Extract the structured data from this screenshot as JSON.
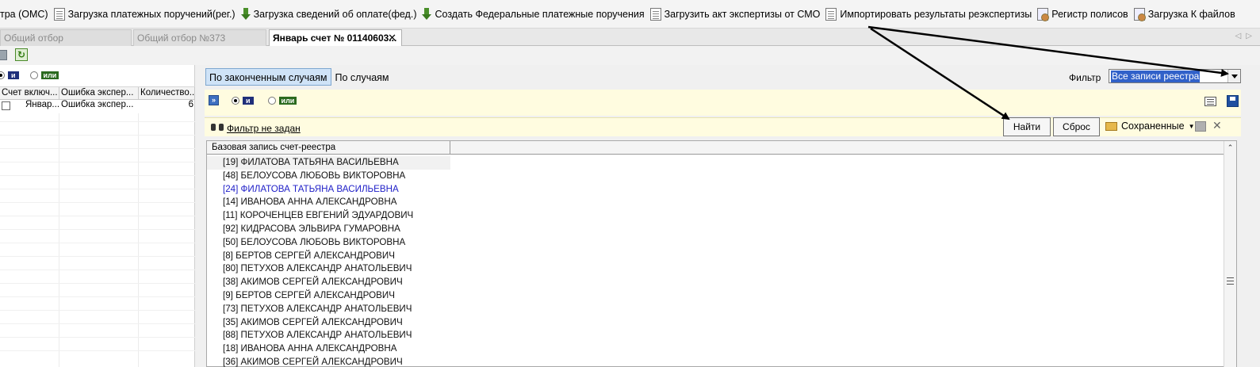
{
  "toolbar": {
    "items": [
      {
        "label": "тра (ОМС)",
        "icon": "none"
      },
      {
        "label": "Загрузка платежных поручений(рег.)",
        "icon": "document-icon"
      },
      {
        "label": "Загрузка сведений об оплате(фед.)",
        "icon": "download-icon"
      },
      {
        "label": "Создать Федеральные платежные поручения",
        "icon": "download-icon"
      },
      {
        "label": "Загрузить акт экспертизы от СМО",
        "icon": "document-icon"
      },
      {
        "label": "Импортировать результаты реэкспертизы",
        "icon": "document-icon"
      },
      {
        "label": "Регистр полисов",
        "icon": "registry-icon"
      },
      {
        "label": "Загрузка К файлов",
        "icon": "registry-icon"
      }
    ]
  },
  "tabs": [
    {
      "label": "Общий отбор",
      "active": false
    },
    {
      "label": "Общий отбор  №373",
      "active": false
    },
    {
      "label": "Январь счет № 01140603...",
      "active": true,
      "close": "✕"
    }
  ],
  "left": {
    "logic": {
      "and": "и",
      "or": "или"
    },
    "columns": [
      "Счет включ...",
      "Ошибка экспер...",
      "Количество..."
    ],
    "rows": [
      {
        "col1": "Январ...",
        "col2": "Ошибка экспер...",
        "col3": "6"
      }
    ]
  },
  "right": {
    "subtabs": [
      "По законченным случаям",
      "По случаям"
    ],
    "filter": {
      "label": "Фильтр",
      "value": "Все записи реестра"
    },
    "logic": {
      "and": "и",
      "or": "или"
    },
    "filter_status": "Фильтр не задан",
    "find_button": "Найти",
    "reset_button": "Сброс",
    "saved_label": "Сохраненные",
    "grid": {
      "header": "Базовая запись счет-реестра",
      "rows": [
        "[19] ФИЛАТОВА ТАТЬЯНА ВАСИЛЬЕВНА",
        "[48] БЕЛОУСОВА ЛЮБОВЬ ВИКТОРОВНА",
        "[24] ФИЛАТОВА ТАТЬЯНА ВАСИЛЬЕВНА",
        "[14] ИВАНОВА АННА АЛЕКСАНДРОВНА",
        "[11] КОРОЧЕНЦЕВ ЕВГЕНИЙ ЭДУАРДОВИЧ",
        "[92] КИДРАСОВА ЭЛЬВИРА ГУМАРОВНА",
        "[50] БЕЛОУСОВА ЛЮБОВЬ ВИКТОРОВНА",
        "[8] БЕРТОВ СЕРГЕЙ АЛЕКСАНДРОВИЧ",
        "[80] ПЕТУХОВ АЛЕКСАНДР АНАТОЛЬЕВИЧ",
        "[38] АКИМОВ СЕРГЕЙ АЛЕКСАНДРОВИЧ",
        "[9] БЕРТОВ СЕРГЕЙ АЛЕКСАНДРОВИЧ",
        "[73] ПЕТУХОВ АЛЕКСАНДР АНАТОЛЬЕВИЧ",
        "[35] АКИМОВ СЕРГЕЙ АЛЕКСАНДРОВИЧ",
        "[88] ПЕТУХОВ АЛЕКСАНДР АНАТОЛЬЕВИЧ",
        "[18] ИВАНОВА АННА АЛЕКСАНДРОВНА",
        "[36] АКИМОВ СЕРГЕЙ АЛЕКСАНДРОВИЧ"
      ]
    }
  },
  "colors": {
    "accent": "#3161c9",
    "selected_row_text": "#2020c8",
    "filter_band": "#fffce0"
  }
}
